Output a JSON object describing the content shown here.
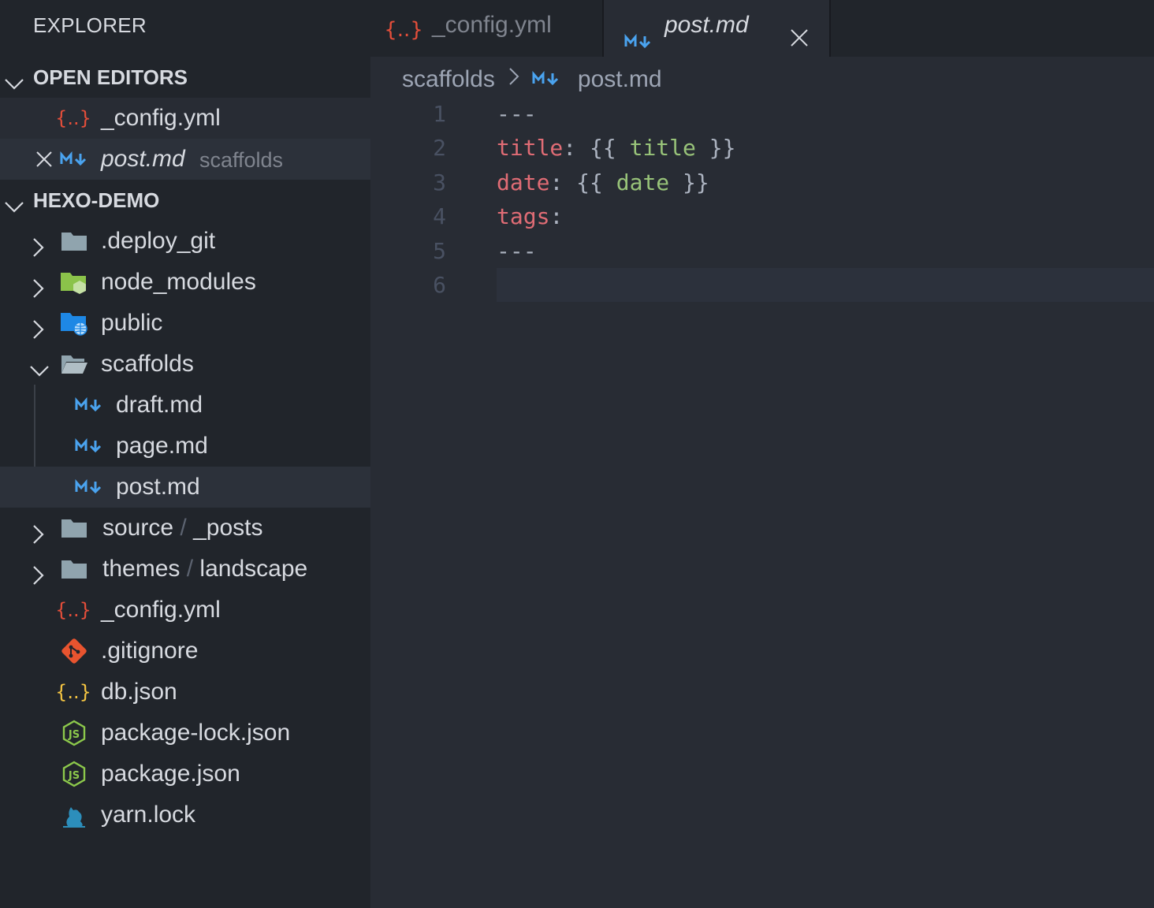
{
  "sidebar": {
    "title": "EXPLORER",
    "open_editors": {
      "header": "OPEN EDITORS",
      "items": [
        {
          "name": "_config.yml",
          "folder": ""
        },
        {
          "name": "post.md",
          "folder": "scaffolds"
        }
      ]
    },
    "project": {
      "header": "HEXO-DEMO",
      "items": [
        {
          "name": ".deploy_git"
        },
        {
          "name": "node_modules"
        },
        {
          "name": "public"
        },
        {
          "name": "scaffolds"
        },
        {
          "name": "draft.md"
        },
        {
          "name": "page.md"
        },
        {
          "name": "post.md"
        },
        {
          "name": "source",
          "sub": "_posts"
        },
        {
          "name": "themes",
          "sub": "landscape"
        },
        {
          "name": "_config.yml"
        },
        {
          "name": ".gitignore"
        },
        {
          "name": "db.json"
        },
        {
          "name": "package-lock.json"
        },
        {
          "name": "package.json"
        },
        {
          "name": "yarn.lock"
        }
      ]
    },
    "path_separator": "/"
  },
  "tabs": [
    {
      "label": "_config.yml",
      "active": false
    },
    {
      "label": "post.md",
      "active": true
    }
  ],
  "breadcrumb": {
    "folder": "scaffolds",
    "file": "post.md"
  },
  "editor": {
    "lines": [
      {
        "n": "1",
        "dash": "---"
      },
      {
        "n": "2",
        "key": "title",
        "colon": ":",
        "open": "{{",
        "var": "title",
        "close": "}}"
      },
      {
        "n": "3",
        "key": "date",
        "colon": ":",
        "open": "{{",
        "var": "date",
        "close": "}}"
      },
      {
        "n": "4",
        "key": "tags",
        "colon": ":"
      },
      {
        "n": "5",
        "dash": "---"
      },
      {
        "n": "6"
      }
    ]
  },
  "colors": {
    "yaml_icon": "#e44e3a",
    "markdown_icon": "#4aa3ef",
    "json_icon": "#f5c542",
    "node_icon": "#8cc84b",
    "git_icon": "#e8542f",
    "yarn_icon": "#2c8ebb",
    "folder_icon": "#90a4ae",
    "public_folder_icon": "#1e88e5",
    "node_modules_folder_icon": "#8bc34a"
  }
}
